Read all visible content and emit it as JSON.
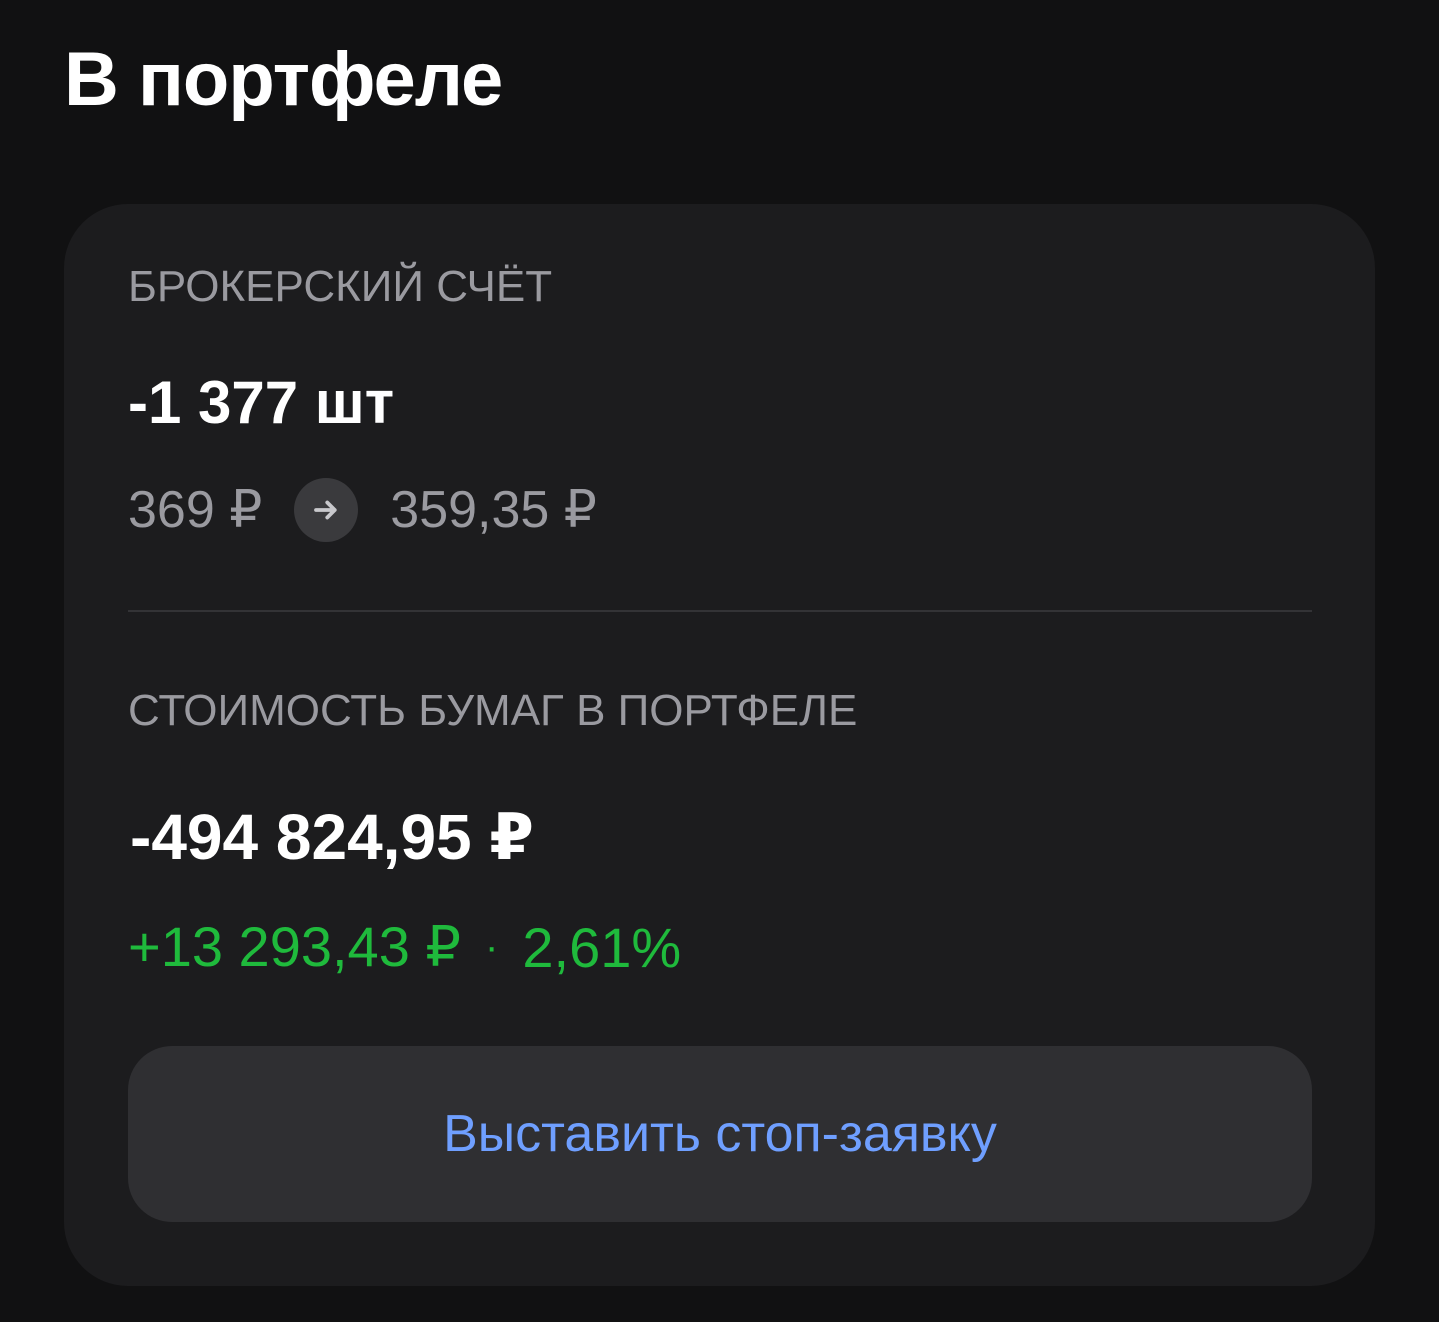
{
  "header": {
    "title": "В портфеле"
  },
  "account": {
    "label": "БРОКЕРСКИЙ СЧЁТ",
    "quantity": "-1 377 шт",
    "avg_price": "369 ₽",
    "arrow_icon": "arrow-right-icon",
    "current_price": "359,35 ₽"
  },
  "portfolio_value": {
    "label": "СТОИМОСТЬ БУМАГ В ПОРТФЕЛЕ",
    "total": "-494 824,95 ₽",
    "pnl_amount": "+13 293,43 ₽",
    "pnl_separator": "·",
    "pnl_percent": "2,61%",
    "pnl_color": "#1fba3c"
  },
  "actions": {
    "stop_order_label": "Выставить стоп-заявку",
    "accent_color": "#6f9fff"
  }
}
